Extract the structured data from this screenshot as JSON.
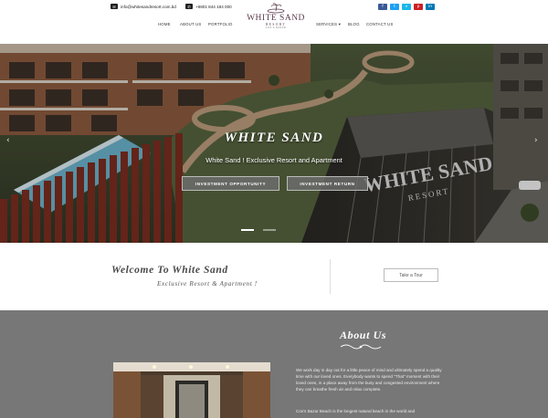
{
  "header": {
    "email": "info@whitesandresort.com.bd",
    "phone": "+8801 844 184 000",
    "email_icon": "envelope-icon",
    "phone_icon": "phone-icon",
    "logo": {
      "brand": "WHITE SAND",
      "sub": "RESORT",
      "tagline": "COX'S BAZAR"
    },
    "nav": [
      "HOME",
      "ABOUT US",
      "PORTFOLIO",
      "SERVICES ▾",
      "BLOG",
      "CONTACT US"
    ],
    "social": [
      {
        "icon": "facebook-icon",
        "glyph": "f",
        "color": "#3b5998"
      },
      {
        "icon": "twitter-icon",
        "glyph": "t",
        "color": "#1da1f2"
      },
      {
        "icon": "vimeo-icon",
        "glyph": "v",
        "color": "#1ab7ea"
      },
      {
        "icon": "pinterest-icon",
        "glyph": "p",
        "color": "#cb2027"
      },
      {
        "icon": "linkedin-icon",
        "glyph": "in",
        "color": "#0077b5"
      }
    ]
  },
  "hero": {
    "title": "WHITE SAND",
    "subtitle": "White Sand ! Exclusive Resort and Apartment",
    "btn_invest": "INVESTMENT OPPORTUNITY",
    "btn_return": "INVESTMENT RETURN",
    "arrow_left": "‹",
    "arrow_right": "›",
    "building_sign": "WHITE SAND RESORT"
  },
  "welcome": {
    "title": "Welcome To White Sand",
    "subtitle": "Exclusive Resort & Apartment !",
    "tour_button": "Take a Tour"
  },
  "about": {
    "title": "About Us",
    "p1": "We work day in day out for a little peace of mind and ultimately spend a quality time with our loved ones. Everybody wants to spend \"That\" moment with their loved ones, in a place away from the busy and congested environment where they can breathe fresh air and relax complete.",
    "p2": "Cox's Bazar Beach is the longest natural beach in the world and"
  },
  "colors": {
    "about_bg": "#777777",
    "logo": "#5a3a4a",
    "button": "#6e6e6e"
  }
}
